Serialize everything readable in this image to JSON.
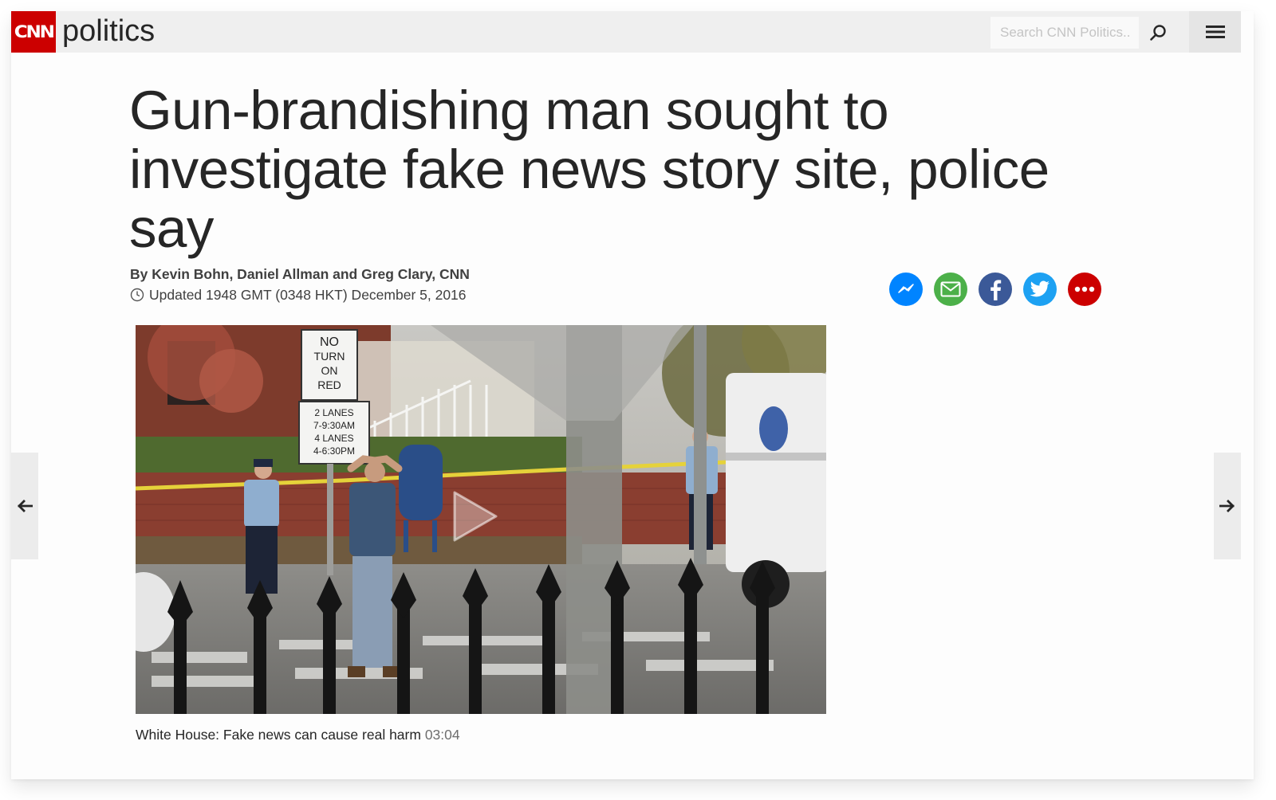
{
  "header": {
    "logo_text": "CNN",
    "section": "politics",
    "search_placeholder": "Search CNN Politics...",
    "search_icon": "search-icon",
    "menu_icon": "hamburger-menu-icon"
  },
  "article": {
    "headline": "Gun-brandishing man sought to investigate fake news story site, police say",
    "byline": "By Kevin Bohn, Daniel Allman and Greg Clary, CNN",
    "updated": "Updated 1948 GMT (0348 HKT) December 5, 2016"
  },
  "share": [
    {
      "name": "messenger",
      "icon": "messenger-icon",
      "color": "#0084ff"
    },
    {
      "name": "email",
      "icon": "email-icon",
      "color": "#4cb049"
    },
    {
      "name": "facebook",
      "icon": "facebook-icon",
      "color": "#3b5998"
    },
    {
      "name": "twitter",
      "icon": "twitter-icon",
      "color": "#1da1f2"
    },
    {
      "name": "more",
      "icon": "more-icon",
      "color": "#cc0000"
    }
  ],
  "video": {
    "caption": "White House: Fake news can cause real harm",
    "duration": "03:04",
    "sign_lines": [
      "NO",
      "TURN",
      "ON",
      "RED"
    ],
    "sign2_lines": [
      "2 LANES",
      "7-9:30AM",
      "4 LANES",
      "4-6:30PM"
    ]
  },
  "colors": {
    "brand_red": "#cc0000",
    "header_bg": "#efefef",
    "text": "#262626"
  }
}
